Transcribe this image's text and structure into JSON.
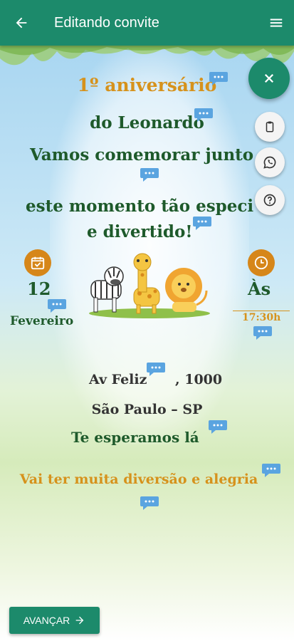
{
  "appbar": {
    "title": "Editando convite"
  },
  "invite": {
    "line1": "1º aniversário",
    "line2": "do Leonardo",
    "line3": "Vamos comemorar junto",
    "line4": "este momento tão especi",
    "line5": "e divertido!",
    "day": "12",
    "month": "Fevereiro",
    "as": "Às",
    "hour": "17:30h",
    "street": "Av Feliz",
    "number": ", 1000",
    "city": "São Paulo – SP",
    "wait": "Te esperamos lá",
    "fun": "Vai ter muita diversão e alegria"
  },
  "actions": {
    "next_label": "AVANÇAR"
  },
  "colors": {
    "primary": "#1c8a6b",
    "accent": "#d6921c",
    "text_green": "#1e5a2b"
  },
  "icons": [
    "back-arrow-icon",
    "menu-icon",
    "close-icon",
    "clipboard-icon",
    "whatsapp-icon",
    "help-icon",
    "calendar-icon",
    "clock-icon",
    "comment-bubble-icon",
    "arrow-right-icon"
  ]
}
